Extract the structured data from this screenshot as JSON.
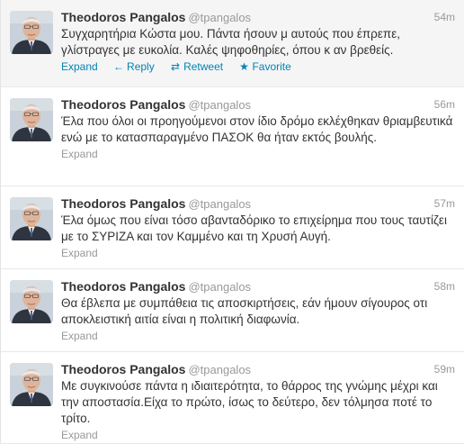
{
  "colors": {
    "link": "#0084b4",
    "muted": "#999999",
    "text": "#333333",
    "hover_bg": "#f5f5f5"
  },
  "actions": {
    "expand_label": "Expand",
    "reply_label": "Reply",
    "retweet_label": "Retweet",
    "favorite_label": "Favorite",
    "reply_icon": "reply-arrow-icon",
    "retweet_icon": "retweet-icon",
    "favorite_icon": "star-icon"
  },
  "tweets": [
    {
      "fullname": "Theodoros Pangalos",
      "username": "@tpangalos",
      "time": "54m",
      "text": "Συγχαρητήρια Κώστα μου. Πάντα ήσουν μ αυτούς που έπρεπε, γλίστραγες με ευκολία. Καλές ψηφοθηρίες, όπου κ αν βρεθείς."
    },
    {
      "fullname": "Theodoros Pangalos",
      "username": "@tpangalos",
      "time": "56m",
      "text": "Έλα που όλοι οι προηγούμενοι στον ίδιο δρόμο εκλέχθηκαν θριαμβευτικά ενώ με το κατασπαραγμένο ΠΑΣΟΚ θα ήταν εκτός βουλής."
    },
    {
      "fullname": "Theodoros Pangalos",
      "username": "@tpangalos",
      "time": "57m",
      "text": "Έλα όμως που είναι τόσο αβανταδόρικο το επιχείρημα που τους ταυτίζει με το ΣΥΡΙΖΑ και τον Καμμένο και τη Χρυσή Αυγή."
    },
    {
      "fullname": "Theodoros Pangalos",
      "username": "@tpangalos",
      "time": "58m",
      "text": "Θα έβλεπα με συμπάθεια τις αποσκιρτήσεις, εάν ήμουν σίγουρος οτι αποκλειστική αιτία είναι η πολιτική διαφωνία."
    },
    {
      "fullname": "Theodoros Pangalos",
      "username": "@tpangalos",
      "time": "59m",
      "text": "Με συγκινούσε πάντα η ιδιαιτερότητα, το θάρρος της γνώμης μέχρι και την αποστασία.Είχα το πρώτο, ίσως το δεύτερο, δεν τόλμησα ποτέ το τρίτο."
    }
  ]
}
